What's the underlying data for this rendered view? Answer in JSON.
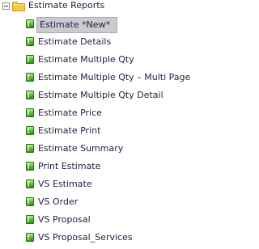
{
  "tree": {
    "root": {
      "label": "Estimate Reports",
      "expanded": true,
      "toggle_icon": "minus-box-icon",
      "icon": "folder-icon"
    },
    "selected_index": 0,
    "item_icon": "report-icon",
    "items": [
      {
        "label": "Estimate *New*"
      },
      {
        "label": "Estimate Details"
      },
      {
        "label": "Estimate Multiple Qty"
      },
      {
        "label": "Estimate Multiple Qty – Multi Page"
      },
      {
        "label": "Estimate Multiple Qty Detail"
      },
      {
        "label": "Estimate Price"
      },
      {
        "label": "Estimate Print"
      },
      {
        "label": "Estimate Summary"
      },
      {
        "label": "Print Estimate"
      },
      {
        "label": "VS Estimate"
      },
      {
        "label": "VS Order"
      },
      {
        "label": "VS Proposal"
      },
      {
        "label": "VS Proposal_Services"
      }
    ]
  },
  "colors": {
    "text": "#222244",
    "selection_bg": "#c9cbd0",
    "folder": "#f2c84b",
    "report_icon": "#4cb52a"
  }
}
